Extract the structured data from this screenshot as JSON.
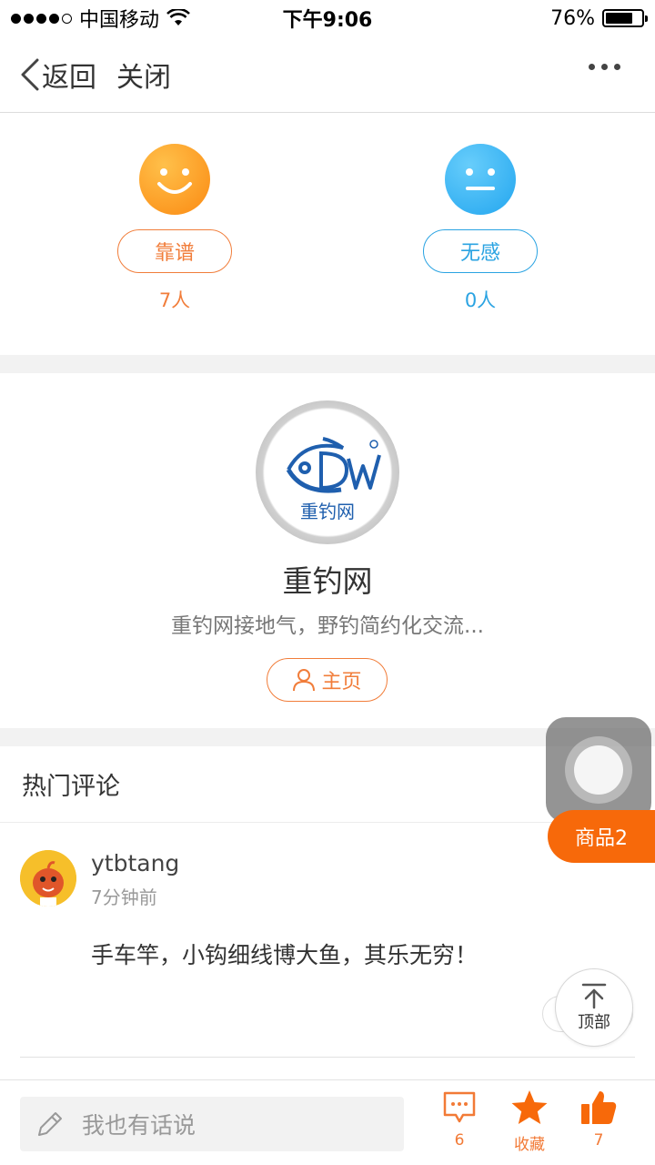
{
  "status_bar": {
    "carrier": "中国移动",
    "time": "下午9:06",
    "battery_pct": "76%",
    "battery_level": 0.76
  },
  "nav": {
    "back_label": "返回",
    "close_label": "关闭"
  },
  "reactions": {
    "good": {
      "label": "靠谱",
      "count": "7人"
    },
    "meh": {
      "label": "无感",
      "count": "0人"
    }
  },
  "author": {
    "logo_text": "重钓网",
    "name": "重钓网",
    "description": "重钓网接地气，野钓简约化交流...",
    "home_label": "主页"
  },
  "comments": {
    "section_title": "热门评论",
    "items": [
      {
        "user": "ytbtang",
        "time": "7分钟前",
        "text": "手车竿，小钩细线博大鱼，其乐无穷！"
      }
    ]
  },
  "floating": {
    "goods_label": "商品2",
    "top_label": "顶部"
  },
  "bottom_bar": {
    "input_placeholder": "我也有话说",
    "comment_count": "6",
    "favorite_label": "收藏",
    "like_count": "7"
  },
  "colors": {
    "accent_orange": "#f17d3a",
    "accent_blue": "#2aa3e2",
    "goods_orange": "#f7690a"
  }
}
